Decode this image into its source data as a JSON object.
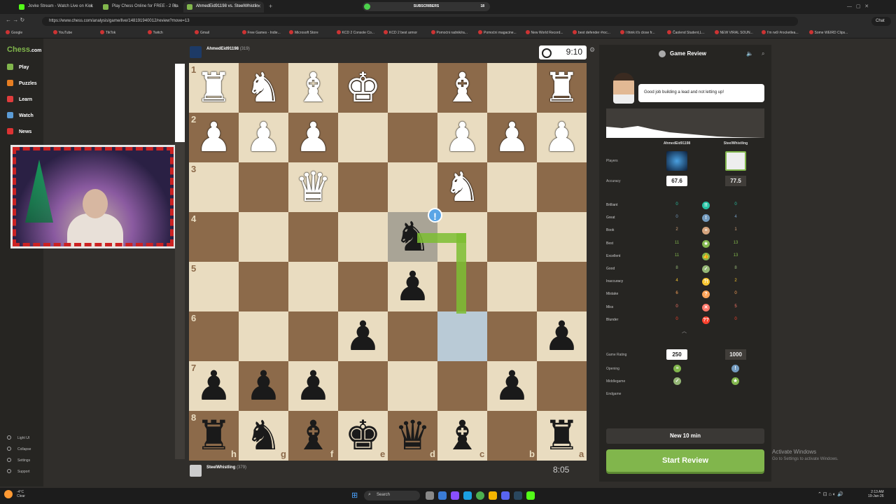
{
  "browser": {
    "tabs": [
      {
        "label": "Jovke Stream - Watch Live on Kick",
        "color": "#53fc18"
      },
      {
        "label": "Play Chess Online for FREE - 2 Pla",
        "color": "#81b64c"
      },
      {
        "label": "AhmedEid91198 vs. SteelWhistlin",
        "color": "#81b64c"
      }
    ],
    "subscribers_label": "SUBSCRIBERS",
    "subscribers_count": "18",
    "url": "https://www.chess.com/analysis/game/live/148191940012/review?move=13",
    "bookmarks": [
      "Google",
      "YouTube",
      "TikTok",
      "Twitch",
      "Gmail",
      "Free Games - Indie...",
      "Microsoft Store",
      "KCD 2 Console Co...",
      "KCD 2 best armor",
      "Pomoćni radnik/ra...",
      "Pomoćni magacine...",
      "New World Record...",
      "best defender #roc...",
      "I think it's close fr...",
      "Čaolend Student,L...",
      "NEW VIRAL SOUN...",
      "I'm rw9 #rocketlea...",
      "Some WEIRD Clips..."
    ],
    "chat_label": "Chat"
  },
  "sidebar": {
    "logo_a": "Chess",
    "logo_b": ".com",
    "items": [
      {
        "label": "Play",
        "color": "#81b64c"
      },
      {
        "label": "Puzzles",
        "color": "#e67e22"
      },
      {
        "label": "Learn",
        "color": "#e03c3c"
      },
      {
        "label": "Watch",
        "color": "#5b9bd5"
      },
      {
        "label": "News",
        "color": "#d33"
      }
    ],
    "footer": [
      "Light UI",
      "Collapse",
      "Settings",
      "Support"
    ]
  },
  "game": {
    "top_player": {
      "name": "AhmedEid91198",
      "rating": "(319)"
    },
    "bottom_player": {
      "name": "SteelWhistling",
      "rating": "(379)"
    },
    "top_clock": "9:10",
    "bottom_clock": "8:05",
    "ranks": [
      "1",
      "2",
      "3",
      "4",
      "5",
      "6",
      "7",
      "8"
    ],
    "files": [
      "h",
      "g",
      "f",
      "e",
      "d",
      "c",
      "b",
      "a"
    ],
    "move_marker": "!",
    "board": [
      [
        "wR",
        "wN",
        "wB",
        "wK",
        "",
        "wB",
        "",
        "wR"
      ],
      [
        "wP",
        "wP",
        "wP",
        "",
        "",
        "wP",
        "wP",
        "wP"
      ],
      [
        "",
        "",
        "wQ",
        "",
        "",
        "wN",
        "",
        ""
      ],
      [
        "",
        "",
        "",
        "",
        "bN",
        "",
        "",
        ""
      ],
      [
        "",
        "",
        "",
        "",
        "bP",
        "",
        "",
        ""
      ],
      [
        "",
        "",
        "",
        "bP",
        "",
        "",
        "",
        "bP"
      ],
      [
        "bP",
        "bP",
        "bP",
        "",
        "",
        "",
        "bP",
        ""
      ],
      [
        "bR",
        "bN",
        "bB",
        "bK",
        "bQ",
        "bB",
        "",
        "bR"
      ]
    ]
  },
  "review": {
    "title": "Game Review",
    "coach_message": "Good job building a lead and not letting up!",
    "players_label": "Players",
    "accuracy_label": "Accuracy",
    "player1": "AhmedEid91198",
    "player2": "SteelWhistling",
    "acc1": "67.6",
    "acc2": "77.5",
    "stats": [
      {
        "label": "Brilliant",
        "v1": "0",
        "v2": "0",
        "color": "#26c2a3",
        "sym": "!!"
      },
      {
        "label": "Great",
        "v1": "0",
        "v2": "4",
        "color": "#749bbf",
        "sym": "!"
      },
      {
        "label": "Book",
        "v1": "2",
        "v2": "1",
        "color": "#d5a47d",
        "sym": "≡"
      },
      {
        "label": "Best",
        "v1": "11",
        "v2": "13",
        "color": "#81b64c",
        "sym": "★"
      },
      {
        "label": "Excellent",
        "v1": "11",
        "v2": "13",
        "color": "#81b64c",
        "sym": "👍"
      },
      {
        "label": "Good",
        "v1": "8",
        "v2": "8",
        "color": "#95b776",
        "sym": "✓"
      },
      {
        "label": "Inaccuracy",
        "v1": "4",
        "v2": "2",
        "color": "#f7c631",
        "sym": "?!"
      },
      {
        "label": "Mistake",
        "v1": "6",
        "v2": "0",
        "color": "#ffa459",
        "sym": "?"
      },
      {
        "label": "Miss",
        "v1": "0",
        "v2": "5",
        "color": "#ff7769",
        "sym": "✕"
      },
      {
        "label": "Blunder",
        "v1": "0",
        "v2": "0",
        "color": "#fa412d",
        "sym": "??"
      }
    ],
    "game_rating_label": "Game Rating",
    "rating1": "250",
    "rating2": "1000",
    "phases": [
      {
        "label": "Opening"
      },
      {
        "label": "Middlegame"
      },
      {
        "label": "Endgame"
      }
    ],
    "new_game_button": "New 10 min",
    "start_review_button": "Start Review"
  },
  "windows": {
    "activate_title": "Activate Windows",
    "activate_sub": "Go to Settings to activate Windows.",
    "search_placeholder": "Search",
    "time": "2:13 AM",
    "date": "19-Jan-26",
    "weather_temp": "-4°C",
    "weather_desc": "Clear"
  }
}
